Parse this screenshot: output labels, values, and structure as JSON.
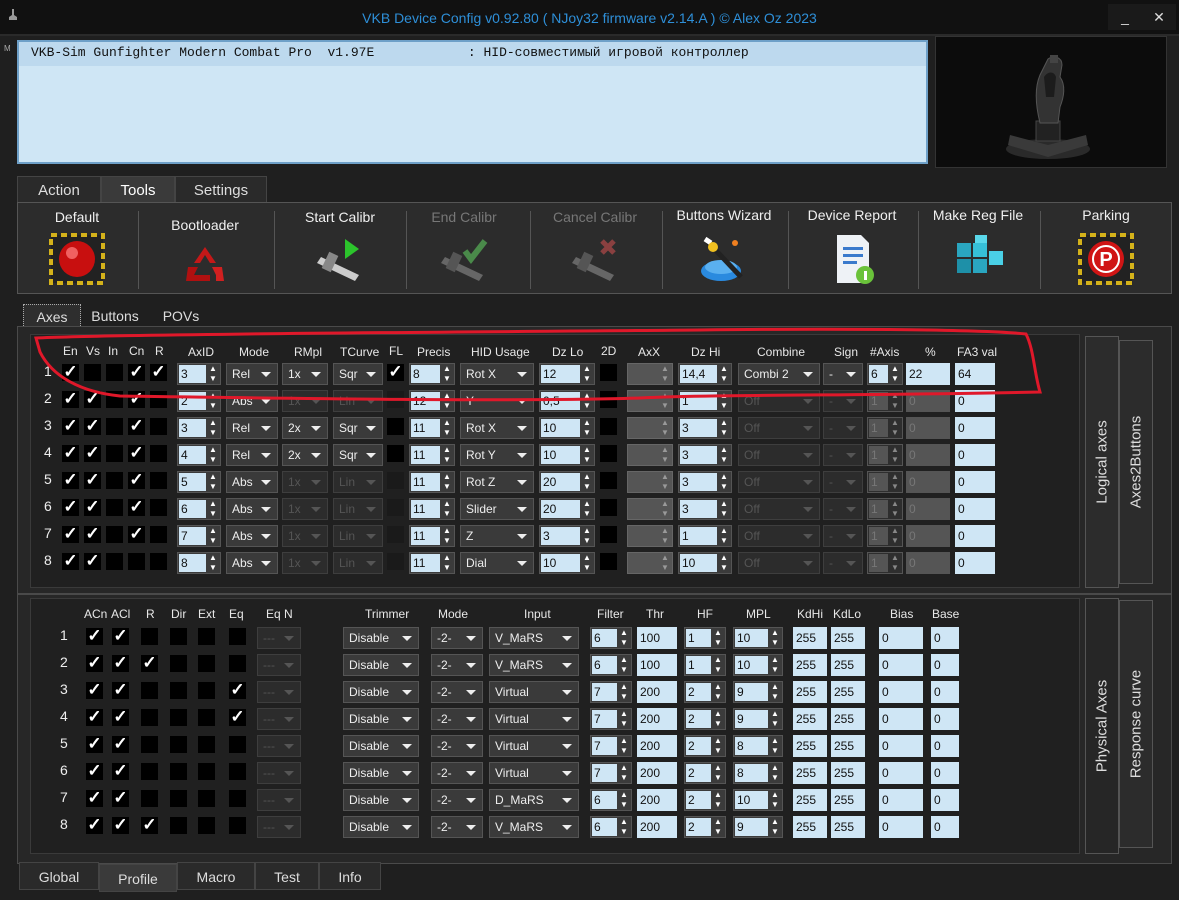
{
  "window": {
    "title": "VKB Device Config v0.92.80 ( NJoy32 firmware v2.14.A ) © Alex Oz 2023",
    "minimize_label": "_",
    "close_label": "✕",
    "stray_glyph": "M"
  },
  "device": {
    "info": "VKB-Sim Gunfighter Modern Combat Pro  v1.97E            : HID-совместимый игровой контроллер",
    "image_icon": "joystick-image"
  },
  "main_tabs": [
    {
      "label": "Action"
    },
    {
      "label": "Tools"
    },
    {
      "label": "Settings"
    }
  ],
  "tools": [
    {
      "label": "Default",
      "icon": "default-reset-icon",
      "enabled": true
    },
    {
      "label": "Bootloader",
      "icon": "recycle-icon",
      "enabled": true
    },
    {
      "label": "Start Calibr",
      "icon": "caliper-play-icon",
      "enabled": true
    },
    {
      "label": "End Calibr",
      "icon": "caliper-check-icon",
      "enabled": false
    },
    {
      "label": "Cancel Calibr",
      "icon": "caliper-cancel-icon",
      "enabled": false
    },
    {
      "label": "Buttons Wizard",
      "icon": "wand-icon",
      "enabled": true
    },
    {
      "label": "Device Report",
      "icon": "report-document-icon",
      "enabled": true
    },
    {
      "label": "Make Reg File",
      "icon": "registry-cubes-icon",
      "enabled": true
    },
    {
      "label": "Parking",
      "icon": "parking-icon",
      "enabled": true
    }
  ],
  "sub_tabs": [
    {
      "label": "Axes"
    },
    {
      "label": "Buttons"
    },
    {
      "label": "POVs"
    }
  ],
  "logical_axes": {
    "headers": {
      "en": "En",
      "vs": "Vs",
      "in": "In",
      "cn": "Cn",
      "r": "R",
      "axid": "AxID",
      "mode": "Mode",
      "rmpl": "RMpl",
      "tcurve": "TCurve",
      "fl": "FL",
      "precis": "Precis",
      "hid": "HID Usage",
      "dzlo": "Dz Lo",
      "twod": "2D",
      "axx": "AxX",
      "dzhi": "Dz Hi",
      "combine": "Combine",
      "sign": "Sign",
      "naxis": "#Axis",
      "pct": "%",
      "fa3": "FA3 val"
    },
    "rows": [
      {
        "n": "1",
        "en": true,
        "vs": false,
        "in": false,
        "cn": true,
        "r": true,
        "axid": "3",
        "mode": "Rel",
        "rmpl": "1x",
        "tcurve": "Sqr",
        "fl": true,
        "precis": "8",
        "hid": "Rot X",
        "dzlo": "12",
        "dzhi": "14,4",
        "combine": "Combi 2",
        "sign": "-",
        "naxis": "6",
        "pct": "22",
        "fa3": "64",
        "mod_on": true,
        "comb_on": true
      },
      {
        "n": "2",
        "en": true,
        "vs": true,
        "in": false,
        "cn": true,
        "r": false,
        "axid": "2",
        "mode": "Abs",
        "rmpl": "1x",
        "tcurve": "Lin",
        "fl": false,
        "precis": "12",
        "hid": "Y",
        "dzlo": "0,5",
        "dzhi": "1",
        "combine": "Off",
        "sign": "-",
        "naxis": "1",
        "pct": "0",
        "fa3": "0",
        "mod_on": false,
        "comb_on": false
      },
      {
        "n": "3",
        "en": true,
        "vs": true,
        "in": false,
        "cn": true,
        "r": false,
        "axid": "3",
        "mode": "Rel",
        "rmpl": "2x",
        "tcurve": "Sqr",
        "fl": false,
        "precis": "11",
        "hid": "Rot X",
        "dzlo": "10",
        "dzhi": "3",
        "combine": "Off",
        "sign": "-",
        "naxis": "1",
        "pct": "0",
        "fa3": "0",
        "mod_on": true,
        "comb_on": false
      },
      {
        "n": "4",
        "en": true,
        "vs": true,
        "in": false,
        "cn": true,
        "r": false,
        "axid": "4",
        "mode": "Rel",
        "rmpl": "2x",
        "tcurve": "Sqr",
        "fl": false,
        "precis": "11",
        "hid": "Rot Y",
        "dzlo": "10",
        "dzhi": "3",
        "combine": "Off",
        "sign": "-",
        "naxis": "1",
        "pct": "0",
        "fa3": "0",
        "mod_on": true,
        "comb_on": false
      },
      {
        "n": "5",
        "en": true,
        "vs": true,
        "in": false,
        "cn": true,
        "r": false,
        "axid": "5",
        "mode": "Abs",
        "rmpl": "1x",
        "tcurve": "Lin",
        "fl": false,
        "precis": "11",
        "hid": "Rot Z",
        "dzlo": "20",
        "dzhi": "3",
        "combine": "Off",
        "sign": "-",
        "naxis": "1",
        "pct": "0",
        "fa3": "0",
        "mod_on": false,
        "comb_on": false
      },
      {
        "n": "6",
        "en": true,
        "vs": true,
        "in": false,
        "cn": true,
        "r": false,
        "axid": "6",
        "mode": "Abs",
        "rmpl": "1x",
        "tcurve": "Lin",
        "fl": false,
        "precis": "11",
        "hid": "Slider",
        "dzlo": "20",
        "dzhi": "3",
        "combine": "Off",
        "sign": "-",
        "naxis": "1",
        "pct": "0",
        "fa3": "0",
        "mod_on": false,
        "comb_on": false
      },
      {
        "n": "7",
        "en": true,
        "vs": true,
        "in": false,
        "cn": true,
        "r": false,
        "axid": "7",
        "mode": "Abs",
        "rmpl": "1x",
        "tcurve": "Lin",
        "fl": false,
        "precis": "11",
        "hid": "Z",
        "dzlo": "3",
        "dzhi": "1",
        "combine": "Off",
        "sign": "-",
        "naxis": "1",
        "pct": "0",
        "fa3": "0",
        "mod_on": false,
        "comb_on": false
      },
      {
        "n": "8",
        "en": true,
        "vs": true,
        "in": false,
        "cn": false,
        "r": false,
        "axid": "8",
        "mode": "Abs",
        "rmpl": "1x",
        "tcurve": "Lin",
        "fl": false,
        "precis": "11",
        "hid": "Dial",
        "dzlo": "10",
        "dzhi": "10",
        "combine": "Off",
        "sign": "-",
        "naxis": "1",
        "pct": "0",
        "fa3": "0",
        "mod_on": false,
        "comb_on": false
      }
    ]
  },
  "physical_axes": {
    "headers": {
      "acn": "ACn",
      "acl": "ACl",
      "r": "R",
      "dir": "Dir",
      "ext": "Ext",
      "eq": "Eq",
      "eqn": "Eq N",
      "trimmer": "Trimmer",
      "mode": "Mode",
      "input": "Input",
      "filter": "Filter",
      "thr": "Thr",
      "hf": "HF",
      "mpl": "MPL",
      "kdhi": "KdHi",
      "kdlo": "KdLo",
      "bias": "Bias",
      "base": "Base"
    },
    "rows": [
      {
        "n": "1",
        "acn": true,
        "acl": true,
        "r": false,
        "dir": false,
        "ext": false,
        "eq": false,
        "eqn": "---",
        "trimmer": "Disable",
        "mode": "-2-",
        "input": "V_MaRS",
        "filter": "6",
        "thr": "100",
        "hf": "1",
        "mpl": "10",
        "kdhi": "255",
        "kdlo": "255",
        "bias": "0",
        "base": "0"
      },
      {
        "n": "2",
        "acn": true,
        "acl": true,
        "r": true,
        "dir": false,
        "ext": false,
        "eq": false,
        "eqn": "---",
        "trimmer": "Disable",
        "mode": "-2-",
        "input": "V_MaRS",
        "filter": "6",
        "thr": "100",
        "hf": "1",
        "mpl": "10",
        "kdhi": "255",
        "kdlo": "255",
        "bias": "0",
        "base": "0"
      },
      {
        "n": "3",
        "acn": true,
        "acl": true,
        "r": false,
        "dir": false,
        "ext": false,
        "eq": true,
        "eqn": "---",
        "trimmer": "Disable",
        "mode": "-2-",
        "input": "Virtual",
        "filter": "7",
        "thr": "200",
        "hf": "2",
        "mpl": "9",
        "kdhi": "255",
        "kdlo": "255",
        "bias": "0",
        "base": "0"
      },
      {
        "n": "4",
        "acn": true,
        "acl": true,
        "r": false,
        "dir": false,
        "ext": false,
        "eq": true,
        "eqn": "---",
        "trimmer": "Disable",
        "mode": "-2-",
        "input": "Virtual",
        "filter": "7",
        "thr": "200",
        "hf": "2",
        "mpl": "9",
        "kdhi": "255",
        "kdlo": "255",
        "bias": "0",
        "base": "0"
      },
      {
        "n": "5",
        "acn": true,
        "acl": true,
        "r": false,
        "dir": false,
        "ext": false,
        "eq": false,
        "eqn": "---",
        "trimmer": "Disable",
        "mode": "-2-",
        "input": "Virtual",
        "filter": "7",
        "thr": "200",
        "hf": "2",
        "mpl": "8",
        "kdhi": "255",
        "kdlo": "255",
        "bias": "0",
        "base": "0"
      },
      {
        "n": "6",
        "acn": true,
        "acl": true,
        "r": false,
        "dir": false,
        "ext": false,
        "eq": false,
        "eqn": "---",
        "trimmer": "Disable",
        "mode": "-2-",
        "input": "Virtual",
        "filter": "7",
        "thr": "200",
        "hf": "2",
        "mpl": "8",
        "kdhi": "255",
        "kdlo": "255",
        "bias": "0",
        "base": "0"
      },
      {
        "n": "7",
        "acn": true,
        "acl": true,
        "r": false,
        "dir": false,
        "ext": false,
        "eq": false,
        "eqn": "---",
        "trimmer": "Disable",
        "mode": "-2-",
        "input": "D_MaRS",
        "filter": "6",
        "thr": "200",
        "hf": "2",
        "mpl": "10",
        "kdhi": "255",
        "kdlo": "255",
        "bias": "0",
        "base": "0"
      },
      {
        "n": "8",
        "acn": true,
        "acl": true,
        "r": true,
        "dir": false,
        "ext": false,
        "eq": false,
        "eqn": "---",
        "trimmer": "Disable",
        "mode": "-2-",
        "input": "V_MaRS",
        "filter": "6",
        "thr": "200",
        "hf": "2",
        "mpl": "9",
        "kdhi": "255",
        "kdlo": "255",
        "bias": "0",
        "base": "0"
      }
    ]
  },
  "side_tabs": {
    "logical_axes": "Logical axes",
    "axes2buttons": "Axes2Buttons",
    "physical_axes": "Physical Axes",
    "response_curve": "Response curve"
  },
  "bottom_tabs": [
    {
      "label": "Global"
    },
    {
      "label": "Profile"
    },
    {
      "label": "Macro"
    },
    {
      "label": "Test"
    },
    {
      "label": "Info"
    }
  ],
  "annotation": {
    "color": "#e0182a"
  }
}
